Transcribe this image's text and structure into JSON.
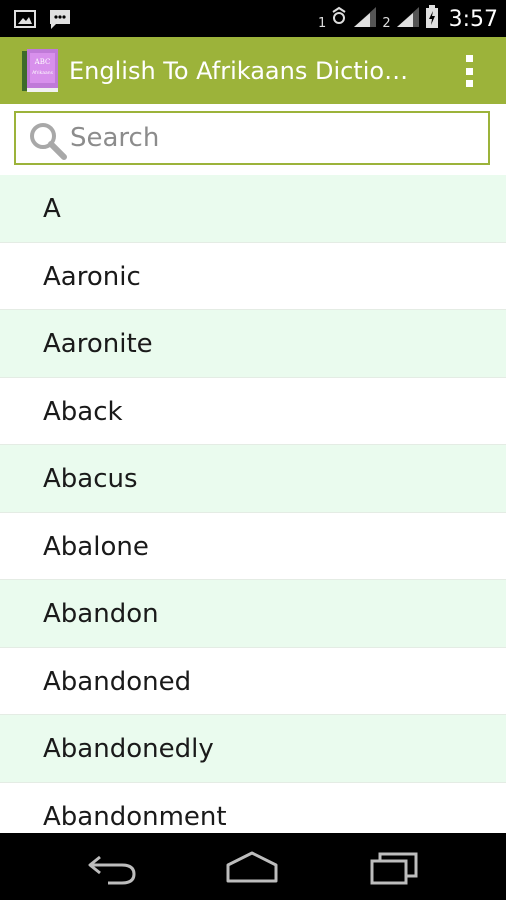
{
  "status_bar": {
    "sim1_label": "1",
    "sim2_label": "2",
    "time": "3:57",
    "icons": [
      "image-icon",
      "message-icon",
      "data-sync-icon",
      "signal-icon",
      "battery-icon"
    ]
  },
  "action_bar": {
    "title": "English To Afrikaans Diction…",
    "app_icon_text_top": "ABC",
    "app_icon_text_bottom": "Afrikaans",
    "background_color": "#9cb33a"
  },
  "search": {
    "placeholder": "Search",
    "value": ""
  },
  "words": [
    "A",
    "Aaronic",
    "Aaronite",
    "Aback",
    "Abacus",
    "Abalone",
    "Abandon",
    "Abandoned",
    "Abandonedly",
    "Abandonment"
  ],
  "nav_bar": {
    "buttons": [
      "back-icon",
      "home-icon",
      "recent-apps-icon"
    ]
  }
}
